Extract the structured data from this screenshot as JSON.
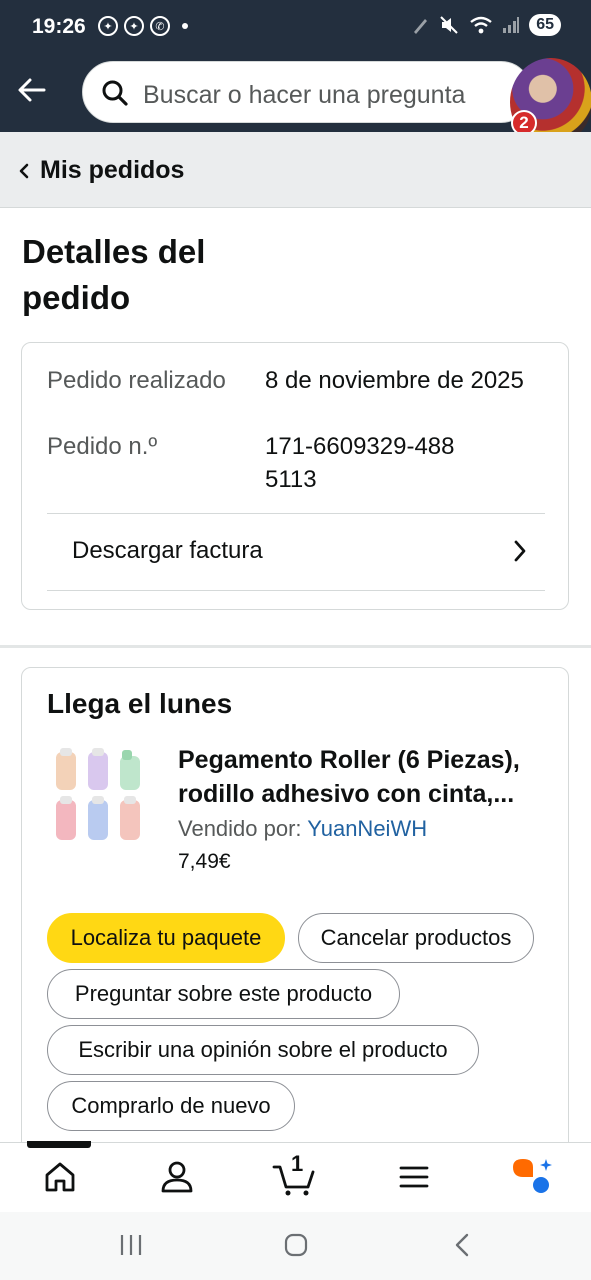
{
  "status_bar": {
    "time": "19:26",
    "battery": "65"
  },
  "header": {
    "search_placeholder": "Buscar o hacer una pregunta",
    "notification_count": "2"
  },
  "breadcrumb": {
    "label": "Mis pedidos"
  },
  "page": {
    "title": "Detalles del pedido"
  },
  "order_info": {
    "placed_label": "Pedido realizado",
    "placed_value": "8 de noviembre de 2025",
    "number_label": "Pedido n.º",
    "number_value": "171-6609329-4885113",
    "invoice_label": "Descargar factura"
  },
  "shipment": {
    "title": "Llega el lunes",
    "product_name_line1": "Pegamento Roller (6 Piezas),",
    "product_name_line2": "rodillo adhesivo con cinta,...",
    "seller_label": "Vendido por:",
    "seller_name": "YuanNeiWH",
    "price": "7,49€",
    "buttons": {
      "track": "Localiza tu paquete",
      "cancel": "Cancelar productos",
      "ask": "Preguntar sobre este producto",
      "review": "Escribir una opinión sobre el producto",
      "buy_again": "Comprarlo de nuevo"
    }
  },
  "bottom_nav": {
    "cart_count": "1"
  },
  "colors": {
    "header_bg": "#232f3e",
    "primary_button": "#ffd814",
    "link": "#2162a1",
    "badge": "#d62b2b"
  }
}
